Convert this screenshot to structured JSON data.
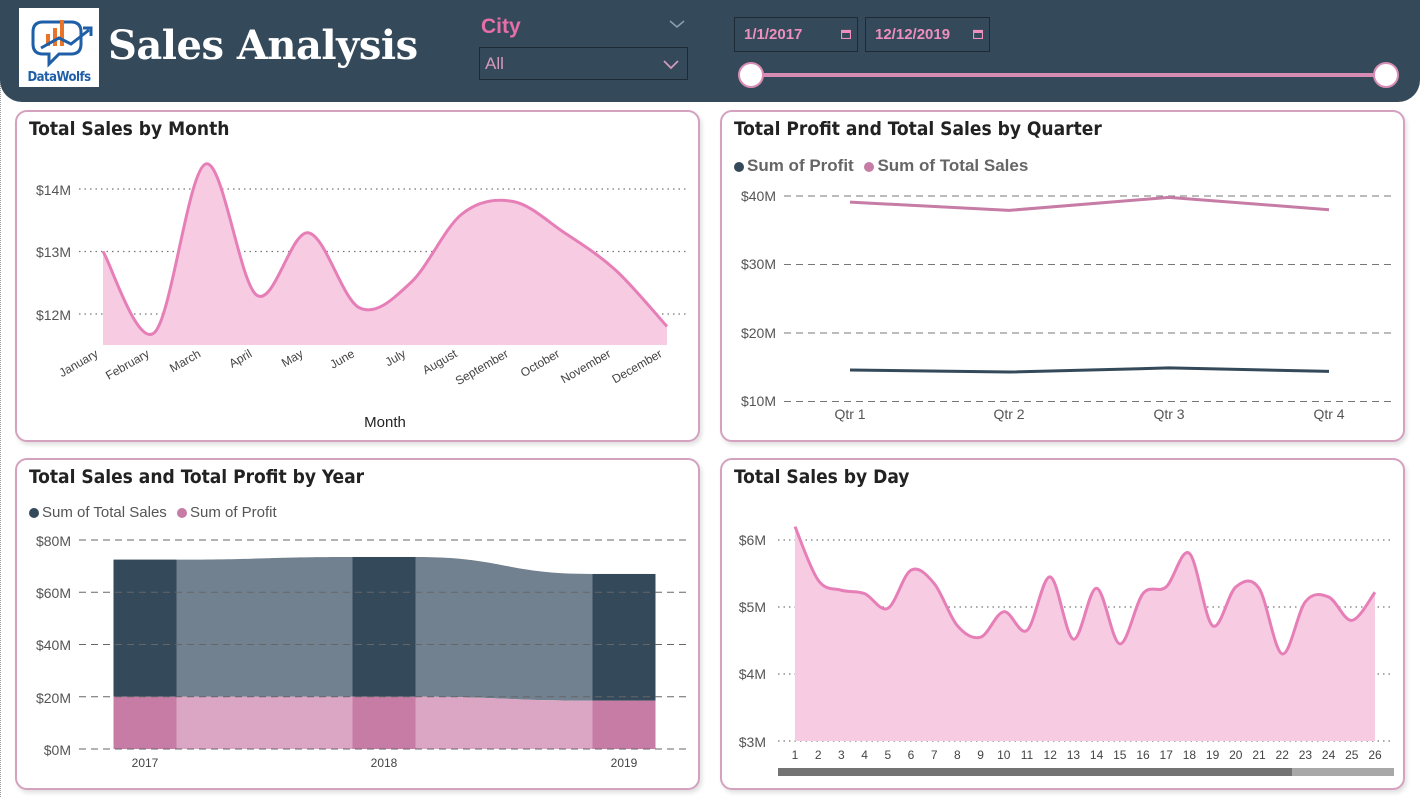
{
  "app": {
    "title": "Sales Analysis",
    "logo_text": "DataWolfs"
  },
  "filters": {
    "city_label": "City",
    "city_value": "All",
    "date_start": "1/1/2017",
    "date_end": "12/12/2019"
  },
  "colors": {
    "header": "#34495a",
    "accent_pink": "#e67fb7",
    "area_pink": "#f7cce3",
    "profit_dark": "#344959",
    "sales_mauve": "#c67ca5"
  },
  "cards": {
    "month": {
      "title": "Total Sales by Month",
      "y_ticks": [
        "$14M",
        "$13M",
        "$12M"
      ],
      "xlabel": "Month"
    },
    "quarter": {
      "title": "Total Profit and Total Sales by Quarter",
      "legend": [
        "Sum of Profit",
        "Sum of Total Sales"
      ],
      "y_ticks": [
        "$40M",
        "$30M",
        "$20M",
        "$10M"
      ]
    },
    "year": {
      "title": "Total Sales and Total Profit by Year",
      "legend": [
        "Sum of Total Sales",
        "Sum of Profit"
      ],
      "y_ticks": [
        "$80M",
        "$60M",
        "$40M",
        "$20M",
        "$0M"
      ]
    },
    "day": {
      "title": "Total Sales by Day",
      "y_ticks": [
        "$6M",
        "$5M",
        "$4M",
        "$3M"
      ]
    }
  },
  "chart_data": [
    {
      "type": "area",
      "title": "Total Sales by Month",
      "xlabel": "Month",
      "ylabel": "",
      "categories": [
        "January",
        "February",
        "March",
        "April",
        "May",
        "June",
        "July",
        "August",
        "September",
        "October",
        "November",
        "December"
      ],
      "values": [
        13.0,
        11.7,
        14.4,
        12.3,
        13.3,
        12.1,
        12.5,
        13.6,
        13.8,
        13.3,
        12.7,
        11.8
      ],
      "ylim": [
        11.5,
        14.6
      ],
      "unit": "$M",
      "grid": true
    },
    {
      "type": "line",
      "title": "Total Profit and Total Sales by Quarter",
      "categories": [
        "Qtr 1",
        "Qtr 2",
        "Qtr 3",
        "Qtr 4"
      ],
      "series": [
        {
          "name": "Sum of Profit",
          "values": [
            14.6,
            14.3,
            14.9,
            14.4
          ]
        },
        {
          "name": "Sum of Total Sales",
          "values": [
            39.1,
            37.9,
            39.8,
            38.0
          ]
        }
      ],
      "ylim": [
        10,
        40
      ],
      "unit": "$M",
      "legend": "top-left",
      "grid": true
    },
    {
      "type": "bar",
      "title": "Total Sales and Total Profit by Year",
      "categories": [
        "2017",
        "2018",
        "2019"
      ],
      "series": [
        {
          "name": "Sum of Total Sales",
          "values": [
            72.5,
            73.5,
            67.0
          ]
        },
        {
          "name": "Sum of Profit",
          "values": [
            20.0,
            20.0,
            18.5
          ]
        }
      ],
      "ylim": [
        0,
        80
      ],
      "unit": "$M",
      "stacked_overlap": true,
      "legend": "top-left",
      "grid": true
    },
    {
      "type": "area",
      "title": "Total Sales by Day",
      "categories": [
        "1",
        "2",
        "3",
        "4",
        "5",
        "6",
        "7",
        "8",
        "9",
        "10",
        "11",
        "12",
        "13",
        "14",
        "15",
        "16",
        "17",
        "18",
        "19",
        "20",
        "21",
        "22",
        "23",
        "24",
        "25",
        "26"
      ],
      "values": [
        6.2,
        5.4,
        5.25,
        5.2,
        4.98,
        5.55,
        5.35,
        4.72,
        4.55,
        4.93,
        4.65,
        5.45,
        4.52,
        5.28,
        4.45,
        5.2,
        5.3,
        5.8,
        4.72,
        5.3,
        5.28,
        4.3,
        5.08,
        5.15,
        4.8,
        5.22
      ],
      "ylim": [
        3,
        6.3
      ],
      "unit": "$M",
      "grid": true
    }
  ]
}
